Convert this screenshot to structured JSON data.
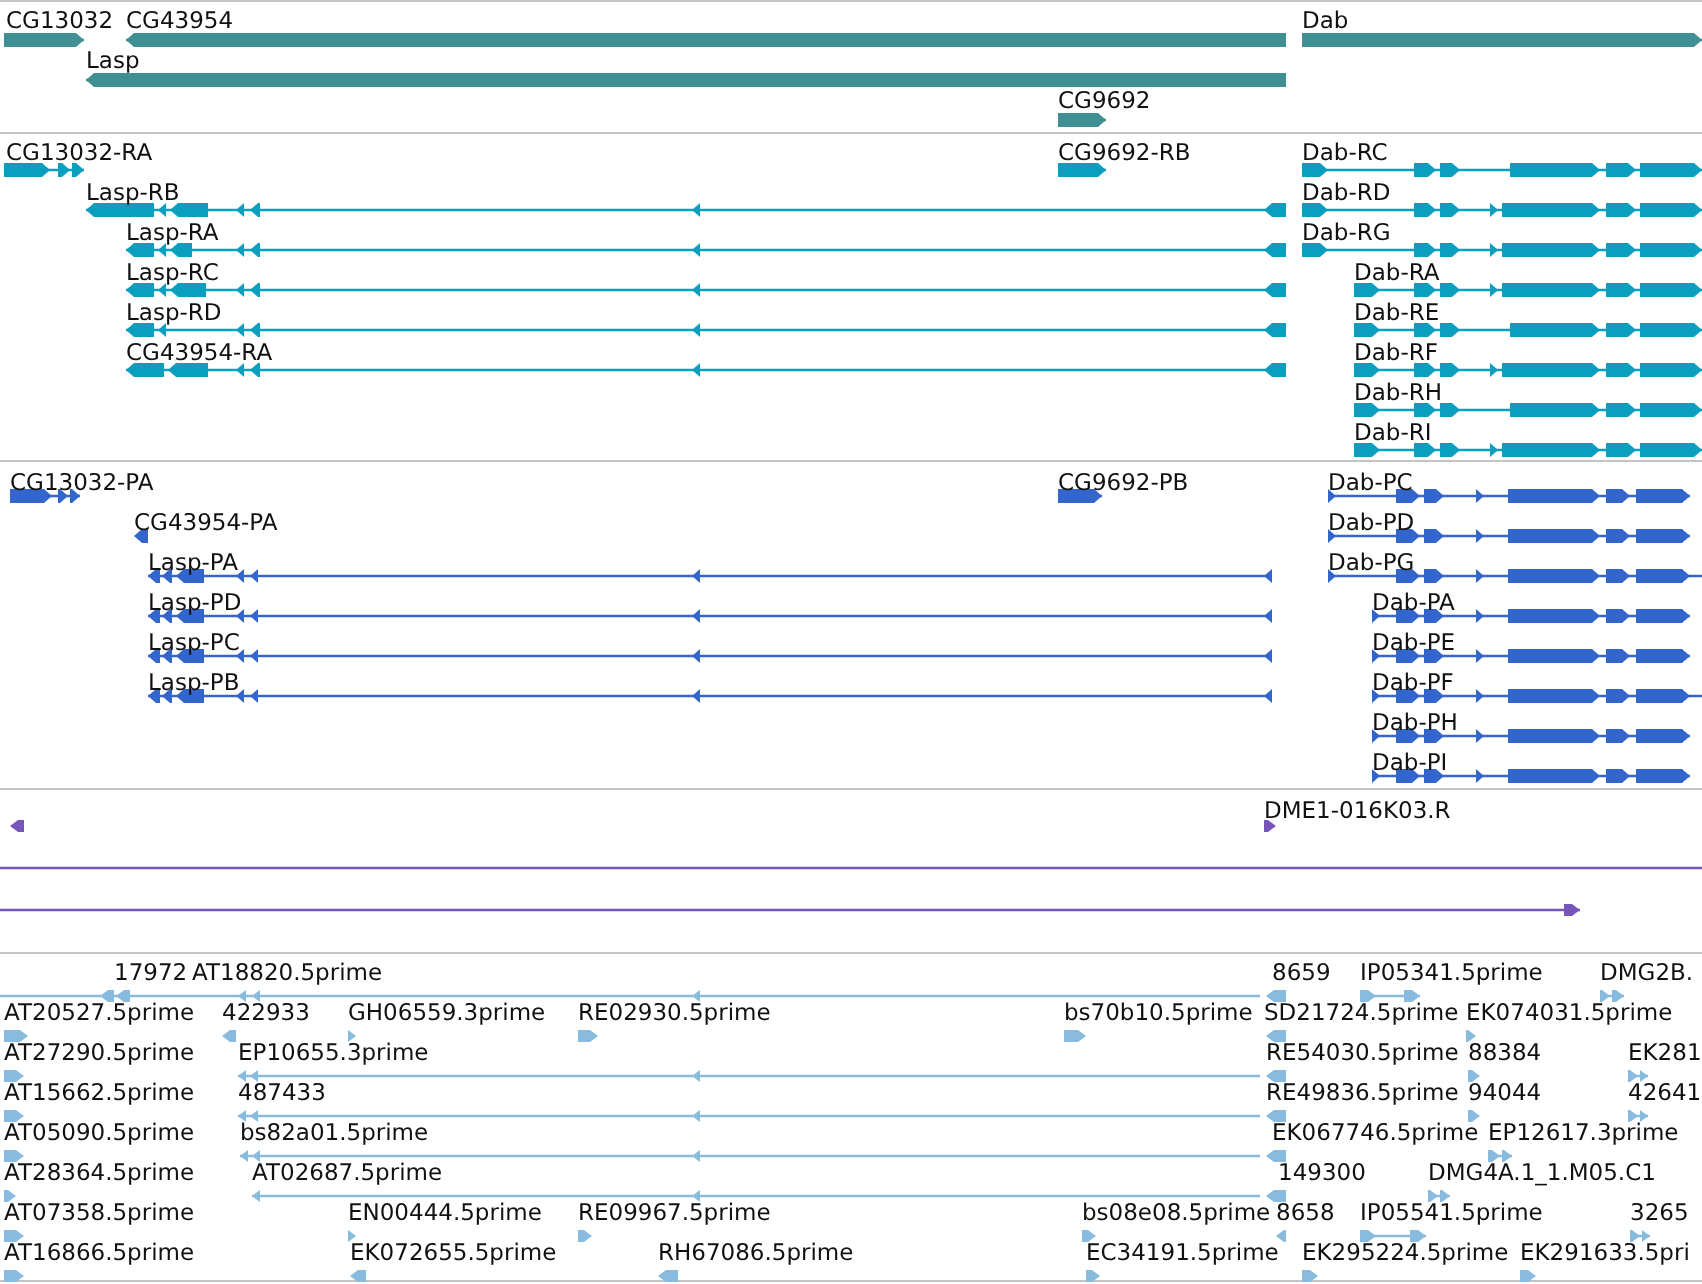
{
  "tracks": [
    {
      "kind": "gene",
      "features": [
        {
          "label": "CG13032",
          "reverse": false
        },
        {
          "label": "CG43954",
          "reverse": true
        },
        {
          "label": "Dab",
          "reverse": false
        },
        {
          "label": "Lasp",
          "reverse": true
        },
        {
          "label": "CG9692",
          "reverse": false
        }
      ]
    },
    {
      "kind": "transcript",
      "features": [
        {
          "label": "CG13032-RA",
          "reverse": false
        },
        {
          "label": "CG9692-RB",
          "reverse": false
        },
        {
          "label": "Dab-RC",
          "reverse": false
        },
        {
          "label": "Lasp-RB",
          "reverse": true
        },
        {
          "label": "Dab-RD",
          "reverse": false
        },
        {
          "label": "Lasp-RA",
          "reverse": true
        },
        {
          "label": "Dab-RG",
          "reverse": false
        },
        {
          "label": "Lasp-RC",
          "reverse": true
        },
        {
          "label": "Dab-RA",
          "reverse": false
        },
        {
          "label": "Lasp-RD",
          "reverse": true
        },
        {
          "label": "Dab-RE",
          "reverse": false
        },
        {
          "label": "CG43954-RA",
          "reverse": true
        },
        {
          "label": "Dab-RF",
          "reverse": false
        },
        {
          "label": "Dab-RH",
          "reverse": false
        },
        {
          "label": "Dab-RI",
          "reverse": false
        }
      ]
    },
    {
      "kind": "protein",
      "features": [
        {
          "label": "CG13032-PA",
          "reverse": false
        },
        {
          "label": "CG9692-PB",
          "reverse": false
        },
        {
          "label": "Dab-PC",
          "reverse": false
        },
        {
          "label": "CG43954-PA",
          "reverse": true
        },
        {
          "label": "Dab-PD",
          "reverse": false
        },
        {
          "label": "Lasp-PA",
          "reverse": true
        },
        {
          "label": "Dab-PG",
          "reverse": false
        },
        {
          "label": "Lasp-PD",
          "reverse": true
        },
        {
          "label": "Dab-PA",
          "reverse": false
        },
        {
          "label": "Lasp-PC",
          "reverse": true
        },
        {
          "label": "Dab-PE",
          "reverse": false
        },
        {
          "label": "Lasp-PB",
          "reverse": true
        },
        {
          "label": "Dab-PF",
          "reverse": false
        },
        {
          "label": "Dab-PH",
          "reverse": false
        },
        {
          "label": "Dab-PI",
          "reverse": false
        }
      ]
    },
    {
      "kind": "alignment",
      "features": [
        {
          "kind": "arrow",
          "reverse": true
        },
        {
          "kind": "arrow",
          "label": "DME1-016K03.R",
          "reverse": false
        },
        {
          "kind": "line"
        },
        {
          "kind": "arrow",
          "reverse": false
        }
      ]
    },
    {
      "kind": "est",
      "features": [
        {
          "label": "17972",
          "reverse": true
        },
        {
          "label": "AT18820.5prime"
        },
        {
          "label": "8659",
          "reverse": true
        },
        {
          "label": "IP05341.5prime",
          "reverse": false
        },
        {
          "label": "DMG2B.",
          "reverse": false
        },
        {
          "label": "AT20527.5prime",
          "reverse": false
        },
        {
          "label": "422933",
          "reverse": true
        },
        {
          "label": "GH06559.3prime",
          "reverse": false
        },
        {
          "label": "RE02930.5prime",
          "reverse": false
        },
        {
          "label": "bs70b10.5prime",
          "reverse": false
        },
        {
          "label": "SD21724.5prime",
          "reverse": true
        },
        {
          "label": "EK074031.5prime",
          "reverse": false
        },
        {
          "label": "AT27290.5prime",
          "reverse": false
        },
        {
          "label": "EP10655.3prime",
          "reverse": true
        },
        {
          "label": "RE54030.5prime",
          "reverse": true
        },
        {
          "label": "88384",
          "reverse": false
        },
        {
          "label": "EK281",
          "reverse": false
        },
        {
          "label": "AT15662.5prime",
          "reverse": false
        },
        {
          "label": "487433",
          "reverse": true
        },
        {
          "label": "RE49836.5prime",
          "reverse": true
        },
        {
          "label": "94044",
          "reverse": false
        },
        {
          "label": "42641",
          "reverse": false
        },
        {
          "label": "AT05090.5prime",
          "reverse": false
        },
        {
          "label": "bs82a01.5prime",
          "reverse": true
        },
        {
          "label": "EK067746.5prime",
          "reverse": true
        },
        {
          "label": "EP12617.3prime",
          "reverse": false
        },
        {
          "label": "AT28364.5prime",
          "reverse": false
        },
        {
          "label": "AT02687.5prime",
          "reverse": true
        },
        {
          "label": "149300",
          "reverse": true
        },
        {
          "label": "DMG4A.1_1.M05.C1",
          "reverse": false
        },
        {
          "label": "AT07358.5prime",
          "reverse": false
        },
        {
          "label": "EN00444.5prime",
          "reverse": false
        },
        {
          "label": "RE09967.5prime",
          "reverse": false
        },
        {
          "label": "bs08e08.5prime",
          "reverse": false
        },
        {
          "label": "8658",
          "reverse": true
        },
        {
          "label": "IP05541.5prime",
          "reverse": false
        },
        {
          "label": "3265",
          "reverse": false
        },
        {
          "label": "AT16866.5prime",
          "reverse": false
        },
        {
          "label": "EK072655.5prime",
          "reverse": true
        },
        {
          "label": "RH67086.5prime",
          "reverse": true
        },
        {
          "label": "EC34191.5prime",
          "reverse": false
        },
        {
          "label": "EK295224.5prime",
          "reverse": false
        },
        {
          "label": "EK291633.5pri",
          "reverse": false
        }
      ]
    }
  ]
}
